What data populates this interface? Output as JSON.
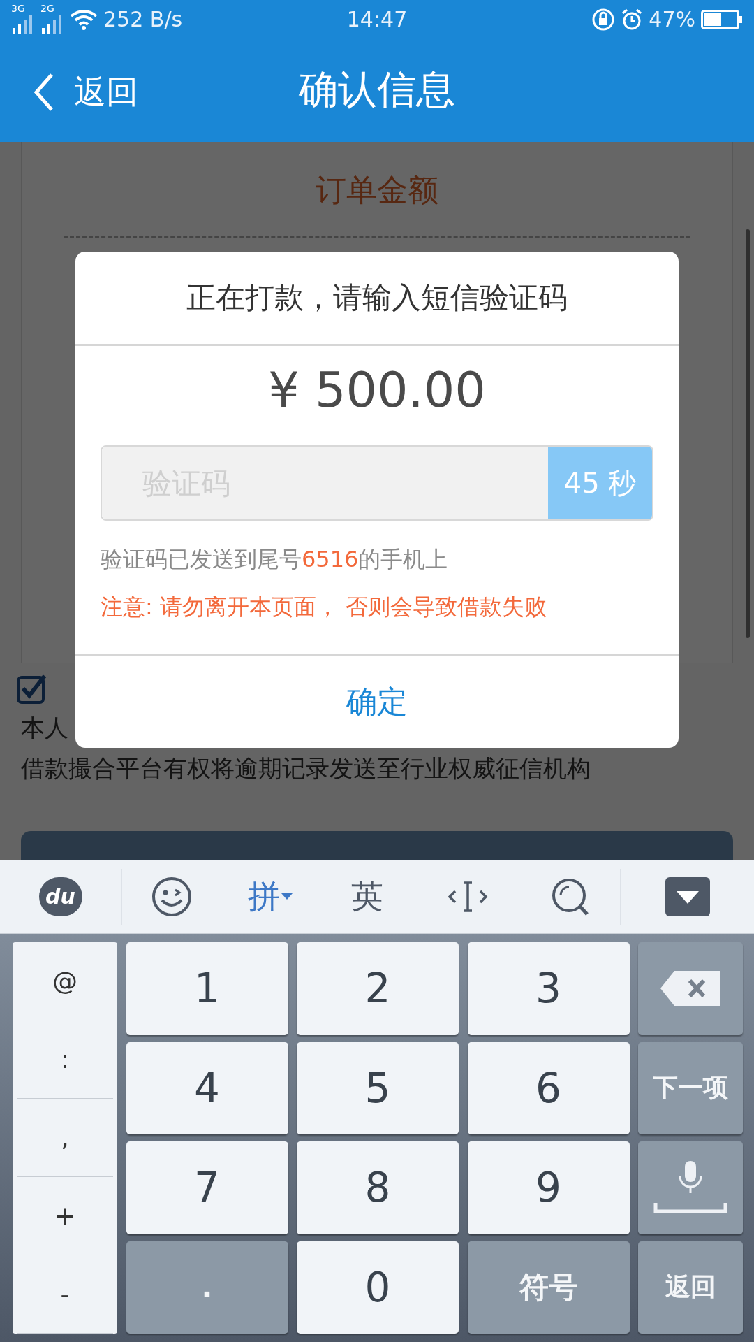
{
  "status_bar": {
    "signals": [
      "3G",
      "2G"
    ],
    "net_speed": "252 B/s",
    "time": "14:47",
    "battery": "47%"
  },
  "header": {
    "back": "返回",
    "title": "确认信息"
  },
  "page": {
    "card_title": "订单金额",
    "agree": {
      "checked": true
    },
    "notice_lines": [
      "本人",
      "借款撮合平台有权将逾期记录发送至行业权威征信机构"
    ]
  },
  "dialog": {
    "title": "正在打款，请输入短信验证码",
    "amount": "¥ 500.00",
    "field": {
      "placeholder": "验证码"
    },
    "countdown": "45 秒",
    "hint": {
      "before": "验证码已发送到尾号",
      "number": "6516",
      "after": "的手机上"
    },
    "warning": "注意: 请勿离开本页面， 否则会导致借款失败",
    "confirm": "确定"
  },
  "keyboard": {
    "toolbar": [
      {
        "kind": "logo",
        "label": "du"
      },
      {
        "kind": "emoji"
      },
      {
        "kind": "lang",
        "label": "拼",
        "selected": true
      },
      {
        "kind": "lang",
        "label": "英",
        "selected": false
      },
      {
        "kind": "cursor"
      },
      {
        "kind": "search"
      },
      {
        "kind": "hide"
      }
    ],
    "symbols": [
      "@",
      ":",
      ",",
      "+",
      "-"
    ],
    "rows": [
      [
        {
          "kind": "digit",
          "label": "1"
        },
        {
          "kind": "digit",
          "label": "2"
        },
        {
          "kind": "digit",
          "label": "3"
        },
        {
          "kind": "backspace"
        }
      ],
      [
        {
          "kind": "digit",
          "label": "4"
        },
        {
          "kind": "digit",
          "label": "5"
        },
        {
          "kind": "digit",
          "label": "6"
        },
        {
          "kind": "func",
          "label": "下一项"
        }
      ],
      [
        {
          "kind": "digit",
          "label": "7"
        },
        {
          "kind": "digit",
          "label": "8"
        },
        {
          "kind": "digit",
          "label": "9"
        },
        {
          "kind": "voice"
        }
      ],
      [
        {
          "kind": "func",
          "label": "."
        },
        {
          "kind": "digit",
          "label": "0"
        },
        {
          "kind": "func",
          "label": "符号"
        },
        {
          "kind": "func",
          "label": "返回"
        }
      ]
    ]
  }
}
